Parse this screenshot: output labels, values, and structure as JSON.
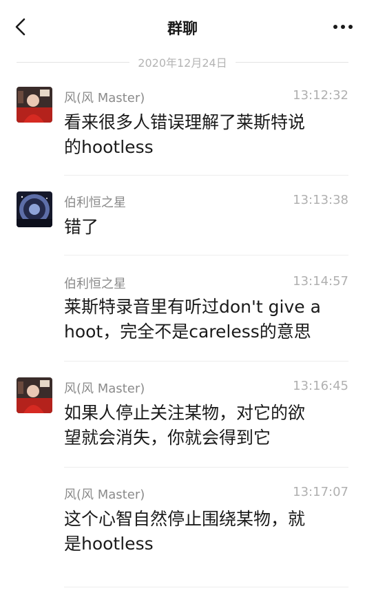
{
  "header": {
    "title": "群聊",
    "back_icon": "chevron-left-icon",
    "more_icon": "more-horizontal-icon"
  },
  "date_separator": "2020年12月24日",
  "messages": [
    {
      "sender": "风(风 Master)",
      "time": "13:12:32",
      "line1": "看来很多人错误理解了莱斯特说",
      "line2": "的hootless",
      "avatar": "avatar-red-portrait"
    },
    {
      "sender": "伯利恒之星",
      "time": "13:13:38",
      "line1": "错了",
      "line2": "",
      "avatar": "avatar-night-sky"
    },
    {
      "sender": "伯利恒之星",
      "time": "13:14:57",
      "line1": "莱斯特录音里有听过don't give a",
      "line2": "hoot，完全不是careless的意思"
    },
    {
      "sender": "风(风 Master)",
      "time": "13:16:45",
      "line1": "如果人停止关注某物，对它的欲",
      "line2": "望就会消失，你就会得到它",
      "avatar": "avatar-red-portrait"
    },
    {
      "sender": "风(风 Master)",
      "time": "13:17:07",
      "line1": "这个心智自然停止围绕某物，就",
      "line2": "是hootless"
    }
  ]
}
